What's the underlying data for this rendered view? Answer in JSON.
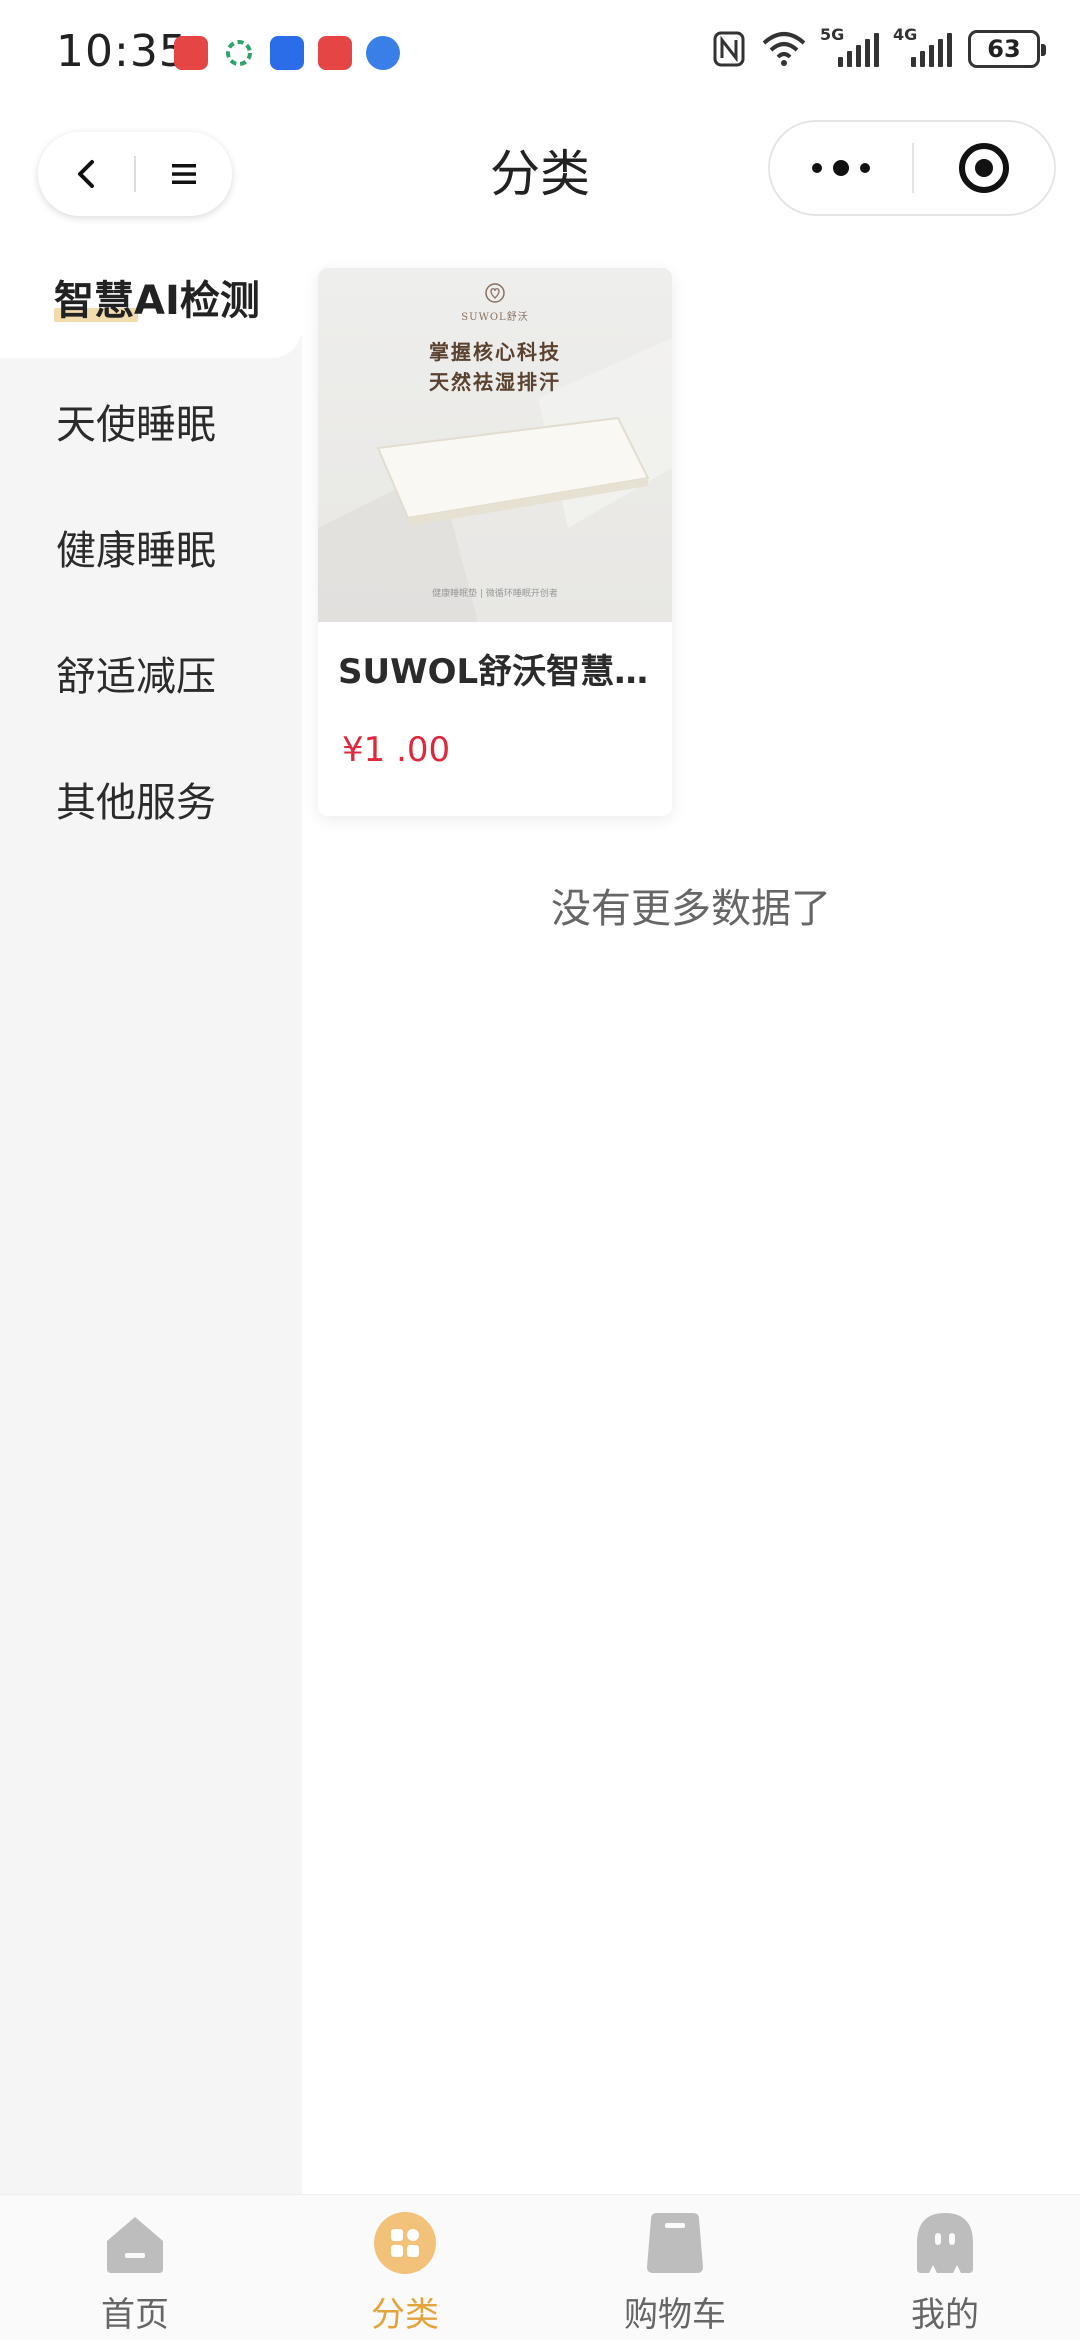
{
  "status_bar": {
    "time": "10:35",
    "network_5g": "5G",
    "network_4g": "4G",
    "battery": "63",
    "app_icons": [
      "huawei-app-icon",
      "mobile-carrier-icon",
      "voice-app-icon",
      "huawei-app-icon",
      "browser-icon"
    ]
  },
  "nav": {
    "title": "分类"
  },
  "sidebar": {
    "items": [
      {
        "label": "智慧AI检测",
        "active": true
      },
      {
        "label": "天使睡眠",
        "active": false
      },
      {
        "label": "健康睡眠",
        "active": false
      },
      {
        "label": "舒适减压",
        "active": false
      },
      {
        "label": "其他服务",
        "active": false
      }
    ]
  },
  "product": {
    "brand": "SUWOL舒沃",
    "headline_line1": "掌握核心科技",
    "headline_line2": "天然祛湿排汗",
    "image_footer": "健康睡眠垫 | 微循环睡眠开创者",
    "name": "SUWOL舒沃智慧…",
    "price": "¥1    .00"
  },
  "list_footer": "没有更多数据了",
  "tabbar": {
    "items": [
      {
        "label": "首页",
        "icon": "home-icon"
      },
      {
        "label": "分类",
        "icon": "category-icon"
      },
      {
        "label": "购物车",
        "icon": "cart-icon"
      },
      {
        "label": "我的",
        "icon": "profile-icon"
      }
    ],
    "active_color": "#e2a43d",
    "inactive_color": "#bdbdbd"
  },
  "colors": {
    "accent": "#e2a43d",
    "price": "#e0283b",
    "sidebar_bg": "#f5f5f5",
    "active_underline": "#f2dcae"
  }
}
